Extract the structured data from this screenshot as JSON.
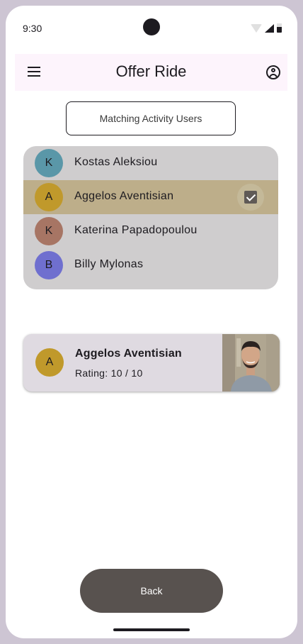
{
  "status_bar": {
    "time": "9:30"
  },
  "app_bar": {
    "title": "Offer Ride"
  },
  "matching_button": {
    "label": "Matching Activity Users"
  },
  "users": [
    {
      "initial": "K",
      "name": "Kostas Aleksiou",
      "avatar_color": "#5a97a8",
      "selected": false
    },
    {
      "initial": "A",
      "name": "Aggelos Aventisian",
      "avatar_color": "#c0992b",
      "selected": true
    },
    {
      "initial": "K",
      "name": "Katerina Papadopoulou",
      "avatar_color": "#a77564",
      "selected": false
    },
    {
      "initial": "B",
      "name": "Billy Mylonas",
      "avatar_color": "#6f6fcf",
      "selected": false
    }
  ],
  "selected_card": {
    "initial": "A",
    "name": "Aggelos Aventisian",
    "rating": "Rating: 10  / 10",
    "avatar_color": "#c0992b"
  },
  "back_button": {
    "label": "Back"
  },
  "colors": {
    "app_bar_bg": "#fdf4fc",
    "list_bg": "#cfcdce",
    "selected_row_bg": "#bdae8a",
    "card_bg": "#dfdae1",
    "back_button_bg": "#58524f"
  }
}
